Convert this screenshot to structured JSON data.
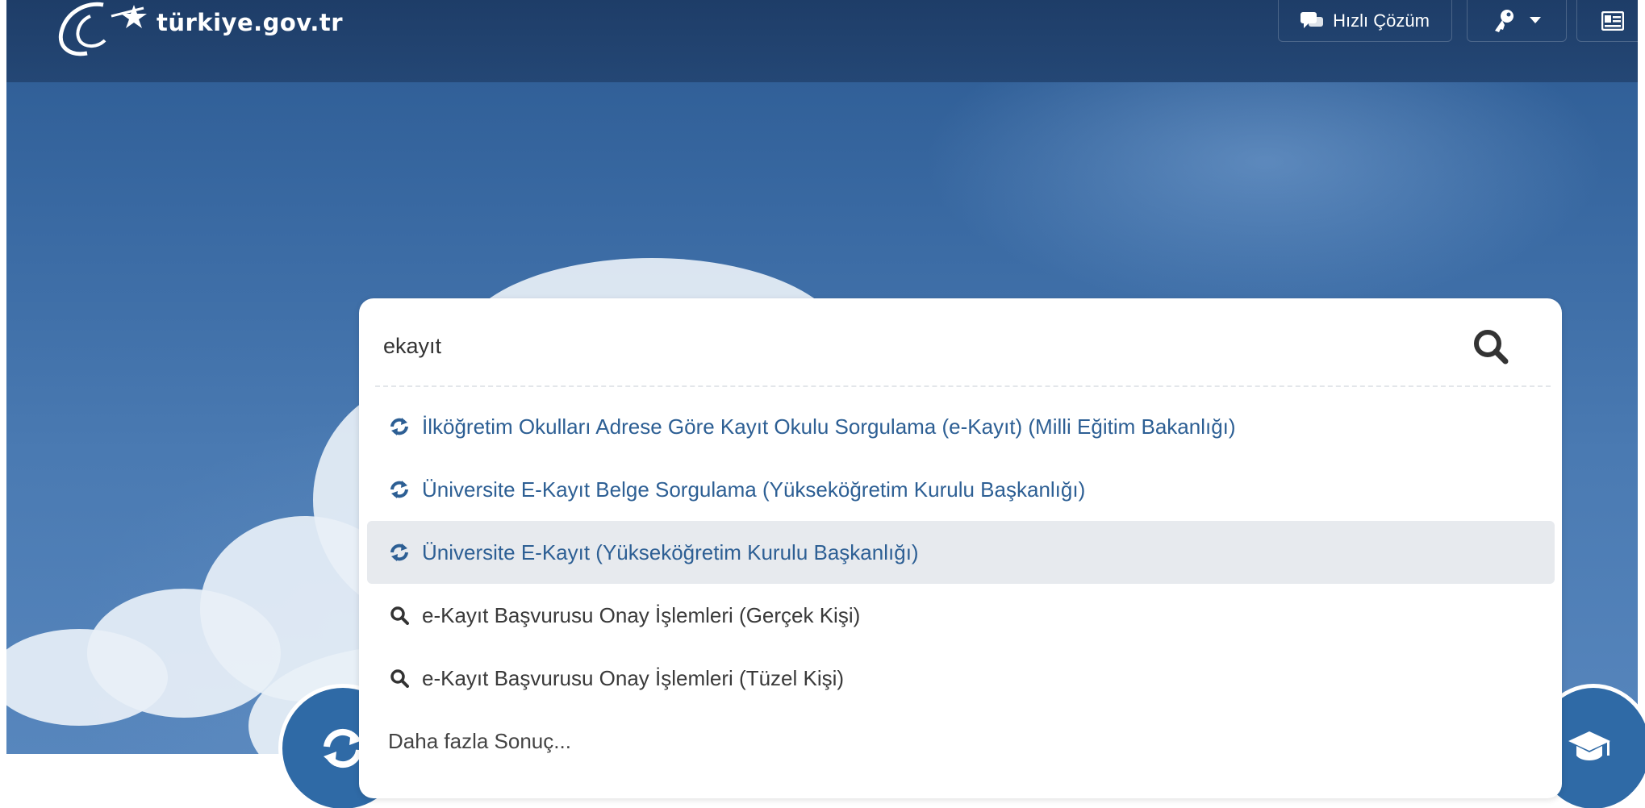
{
  "header": {
    "logo_text": "türkiye.gov.tr",
    "quick_solution_label": "Hızlı Çözüm"
  },
  "search": {
    "value": "ekayıt",
    "placeholder": ""
  },
  "suggestions": {
    "items": [
      {
        "text": "İlköğretim Okulları Adrese Göre Kayıt Okulu Sorgulama (e-Kayıt) (Milli Eğitim Bakanlığı)",
        "icon": "service-refresh-icon"
      },
      {
        "text": "Üniversite E-Kayıt Belge Sorgulama (Yükseköğretim Kurulu Başkanlığı)",
        "icon": "service-refresh-icon"
      },
      {
        "text": "Üniversite E-Kayıt (Yükseköğretim Kurulu Başkanlığı)",
        "icon": "service-refresh-icon",
        "highlighted": true
      },
      {
        "text": "e-Kayıt Başvurusu Onay İşlemleri (Gerçek Kişi)",
        "icon": "search-icon"
      },
      {
        "text": "e-Kayıt Başvurusu Onay İşlemleri (Tüzel Kişi)",
        "icon": "search-icon"
      }
    ],
    "more_label": "Daha fazla Sonuç..."
  },
  "colors": {
    "topbar": "#1e3d68",
    "accent": "#2d5f94",
    "highlight": "#e7eaee"
  }
}
